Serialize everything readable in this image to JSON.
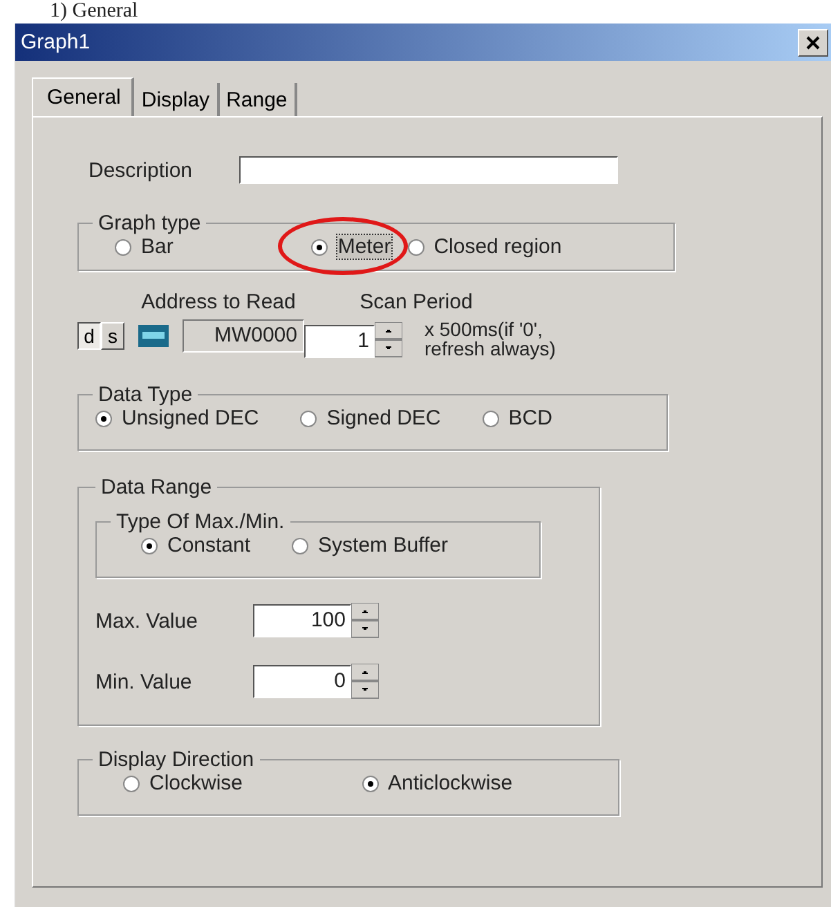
{
  "heading": "1) General",
  "window": {
    "title": "Graph1"
  },
  "tabs": [
    {
      "label": "General",
      "selected": true
    },
    {
      "label": "Display",
      "selected": false
    },
    {
      "label": "Range",
      "selected": false
    }
  ],
  "description": {
    "label": "Description"
  },
  "graph_type": {
    "title": "Graph type",
    "options": [
      {
        "label": "Bar",
        "selected": false,
        "highlighted": false
      },
      {
        "label": "Meter",
        "selected": true,
        "highlighted": true
      },
      {
        "label": "Closed region",
        "selected": false,
        "highlighted": false
      }
    ]
  },
  "address": {
    "label": "Address to Read",
    "modes": [
      {
        "label": "d",
        "selected": true
      },
      {
        "label": "s",
        "selected": false
      }
    ],
    "value": "MW0000"
  },
  "scan_period": {
    "label": "Scan Period",
    "value": "1",
    "note_lines": [
      "x 500ms(if '0',",
      "refresh always)"
    ]
  },
  "data_type": {
    "title": "Data Type",
    "options": [
      {
        "label": "Unsigned DEC",
        "selected": true
      },
      {
        "label": "Signed DEC",
        "selected": false
      },
      {
        "label": "BCD",
        "selected": false
      }
    ]
  },
  "data_range": {
    "title": "Data Range",
    "type_group": {
      "title": "Type Of Max./Min.",
      "options": [
        {
          "label": "Constant",
          "selected": true
        },
        {
          "label": "System Buffer",
          "selected": false
        }
      ]
    },
    "fields": [
      {
        "label": "Max. Value",
        "value": "100"
      },
      {
        "label": "Min. Value",
        "value": "0"
      }
    ]
  },
  "display_direction": {
    "title": "Display Direction",
    "options": [
      {
        "label": "Clockwise",
        "selected": false
      },
      {
        "label": "Anticlockwise",
        "selected": true
      }
    ]
  }
}
